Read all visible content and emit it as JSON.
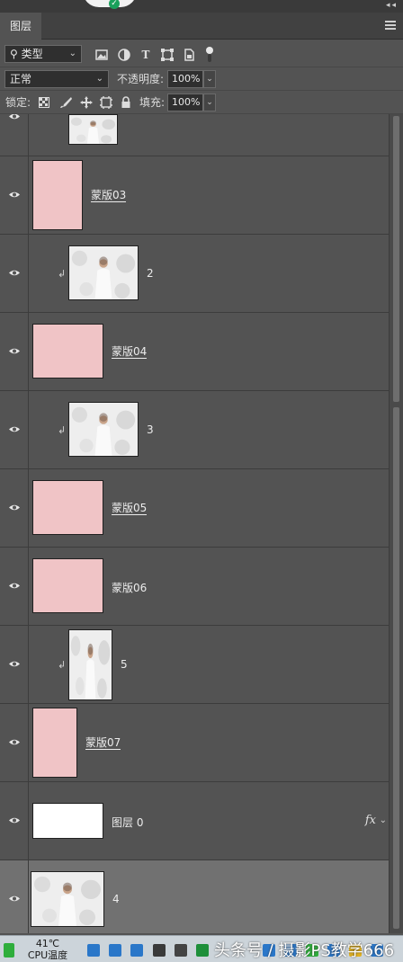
{
  "panel": {
    "tab_label": "图层",
    "collapse_glyph": "◂◂"
  },
  "filter": {
    "kind_label": "类型",
    "icons": [
      "image-filter-icon",
      "adjustment-filter-icon",
      "type-filter-icon",
      "shape-filter-icon",
      "smart-object-filter-icon",
      "filter-toggle-icon"
    ]
  },
  "blend": {
    "mode": "正常",
    "opacity_label": "不透明度:",
    "opacity_value": "100%"
  },
  "lock": {
    "label": "锁定:",
    "fill_label": "填充:",
    "fill_value": "100%",
    "icons": [
      "lock-transparent-icon",
      "lock-image-icon",
      "lock-position-icon",
      "lock-artboard-icon",
      "lock-all-icon"
    ]
  },
  "layers": [
    {
      "name": "",
      "thumb": "photo",
      "clipped": false,
      "visible": true,
      "partial": true
    },
    {
      "name": "蒙版03",
      "thumb": "pink",
      "clipped": false,
      "visible": true,
      "underline": true
    },
    {
      "name": "2",
      "thumb": "photo",
      "clipped": true,
      "visible": true
    },
    {
      "name": "蒙版04",
      "thumb": "pink",
      "clipped": false,
      "visible": true,
      "underline": true
    },
    {
      "name": "3",
      "thumb": "photo",
      "clipped": true,
      "visible": true
    },
    {
      "name": "蒙版05",
      "thumb": "pink",
      "clipped": false,
      "visible": true,
      "underline": true
    },
    {
      "name": "蒙版06",
      "thumb": "pink",
      "clipped": false,
      "visible": true
    },
    {
      "name": "5",
      "thumb": "photo",
      "clipped": true,
      "visible": true
    },
    {
      "name": "蒙版07",
      "thumb": "pink",
      "clipped": false,
      "visible": true,
      "underline": true
    },
    {
      "name": "图层 0",
      "thumb": "white",
      "clipped": false,
      "visible": true,
      "fx": true
    },
    {
      "name": "4",
      "thumb": "photo",
      "clipped": false,
      "visible": true,
      "selected": true
    }
  ],
  "fx_label": "fx",
  "clip_glyph": "↲",
  "taskbar": {
    "temp": "41℃",
    "temp_label": "CPU温度",
    "watermark": "头条号 / 摄影PS教学666"
  },
  "colors": {
    "panel_bg": "#535353",
    "selected_row": "#717171",
    "mask_pink": "#f0c4c6"
  }
}
